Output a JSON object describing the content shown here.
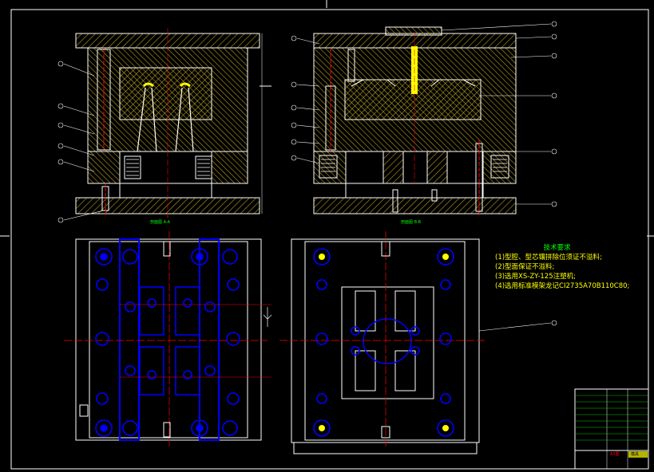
{
  "tech_requirements": {
    "title": "技术要求",
    "items": [
      "(1)型腔、型芯镶拼除位须证不溢料;",
      "(2)型面保证不溢料;",
      "(3)选用XS-ZY-125注塑机;",
      "(4)选用标准模架龙记CI2735A70B110C80;"
    ]
  },
  "section_labels": {
    "left": "剖面图 A-A",
    "right": "剖面图 B-B"
  },
  "title_block": {
    "code": "A3图",
    "mark": "模具"
  },
  "colors": {
    "background": "#000000",
    "outline": "#ffffff",
    "hatch": "#ffff00",
    "hole": "#0000ff",
    "center": "#ff0000",
    "leader": "#ffffff",
    "text": "#ffff00",
    "title": "#00ff00"
  }
}
